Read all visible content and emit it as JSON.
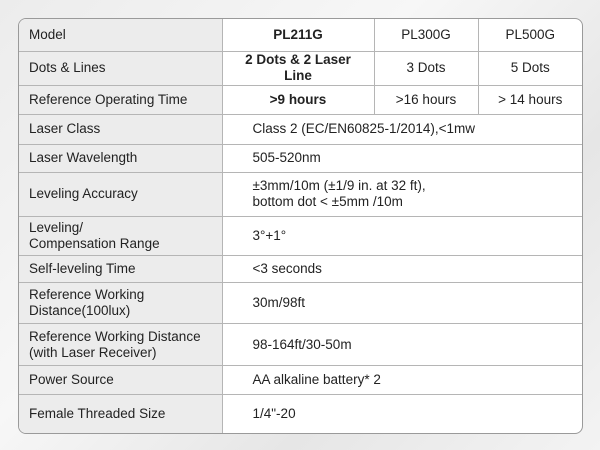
{
  "rows": [
    {
      "label": "Model",
      "c1": "PL211G",
      "c2": "PL300G",
      "c3": "PL500G"
    },
    {
      "label": "Dots & Lines",
      "c1": "2 Dots & 2 Laser Line",
      "c2": "3 Dots",
      "c3": "5 Dots"
    },
    {
      "label": "Reference Operating Time",
      "c1": ">9 hours",
      "c2": ">16 hours",
      "c3": "> 14 hours"
    },
    {
      "label": "Laser Class",
      "value": "Class 2 (EC/EN60825-1/2014),<1mw"
    },
    {
      "label": "Laser Wavelength",
      "value": "505-520nm"
    },
    {
      "label": "Leveling Accuracy",
      "value_line1": "±3mm/10m (±1/9 in. at 32 ft),",
      "value_line2": "bottom dot < ±5mm /10m"
    },
    {
      "label_line1": "Leveling/",
      "label_line2": "Compensation Range",
      "value": "3°+1°"
    },
    {
      "label": "Self-leveling Time",
      "value": "<3 seconds"
    },
    {
      "label_line1": "Reference Working",
      "label_line2": "Distance(100lux)",
      "value": "30m/98ft"
    },
    {
      "label_line1": "Reference Working Distance",
      "label_line2": "(with Laser Receiver)",
      "value": "98-164ft/30-50m"
    },
    {
      "label": "Power Source",
      "value": "AA alkaline battery* 2"
    },
    {
      "label": "Female Threaded Size",
      "value": "1/4\"-20"
    }
  ]
}
